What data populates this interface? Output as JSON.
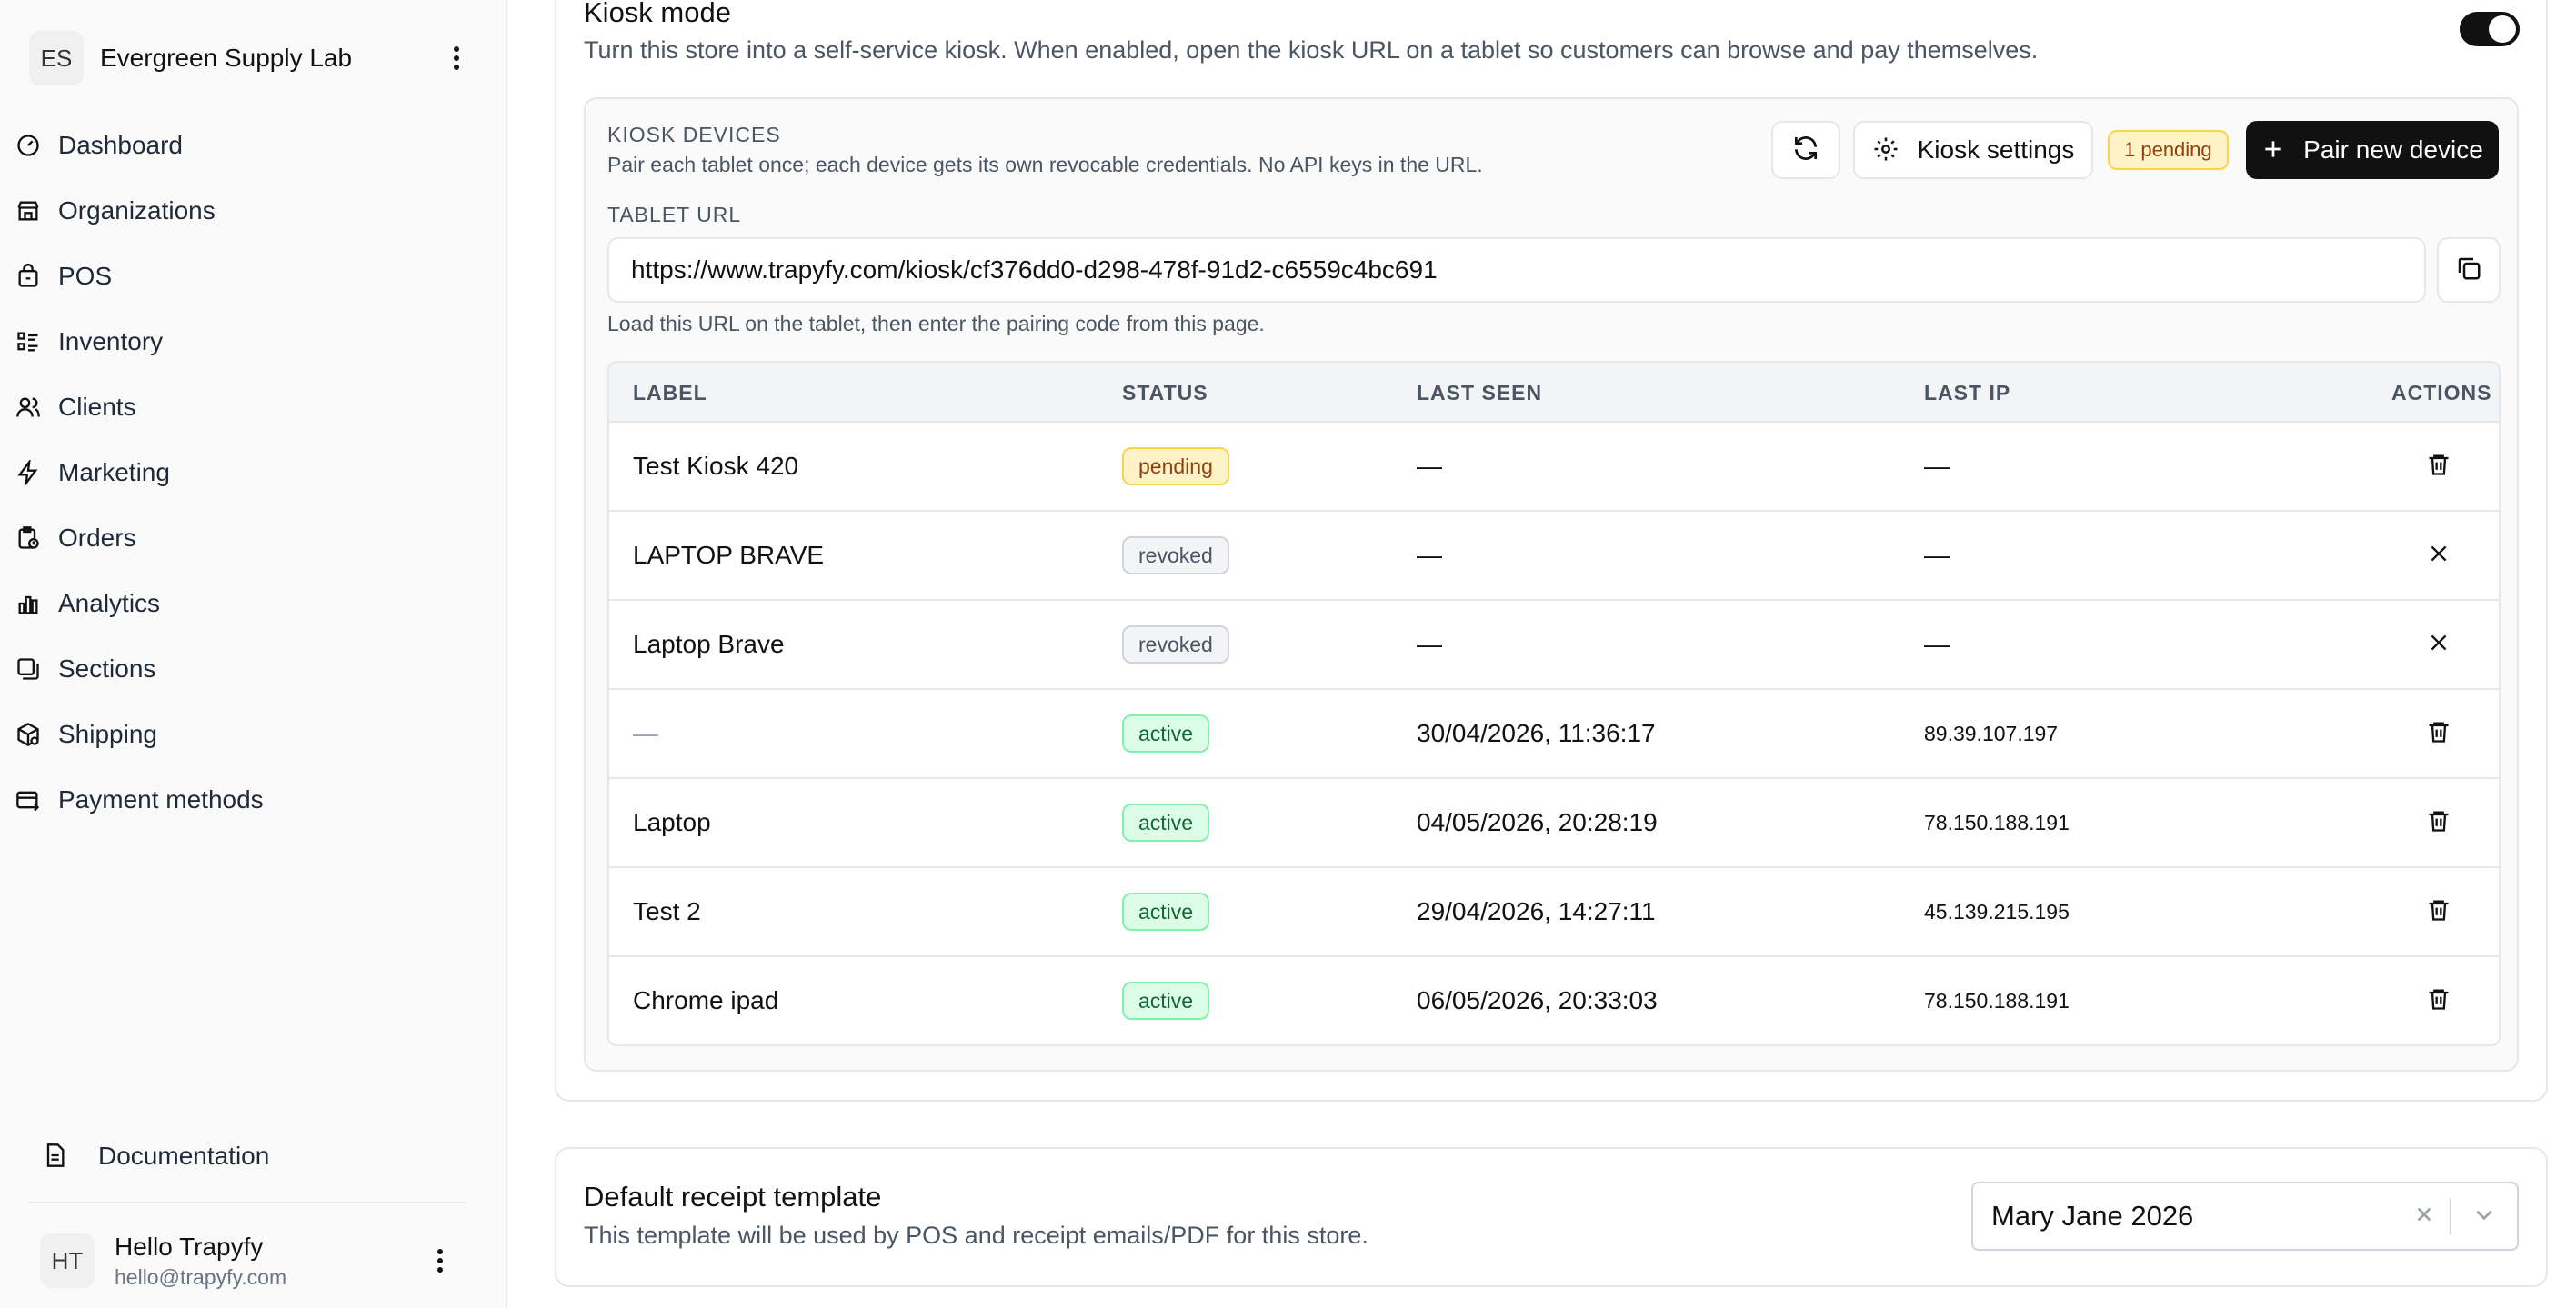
{
  "sidebar": {
    "org": {
      "initials": "ES",
      "name": "Evergreen Supply Lab"
    },
    "items": [
      {
        "label": "Dashboard",
        "icon": "dashboard-icon"
      },
      {
        "label": "Organizations",
        "icon": "store-icon"
      },
      {
        "label": "POS",
        "icon": "bag-icon"
      },
      {
        "label": "Inventory",
        "icon": "list-icon"
      },
      {
        "label": "Clients",
        "icon": "users-icon"
      },
      {
        "label": "Marketing",
        "icon": "bolt-icon"
      },
      {
        "label": "Orders",
        "icon": "clipboard-icon"
      },
      {
        "label": "Analytics",
        "icon": "chart-icon"
      },
      {
        "label": "Sections",
        "icon": "copy-icon"
      },
      {
        "label": "Shipping",
        "icon": "package-icon"
      },
      {
        "label": "Payment methods",
        "icon": "card-icon"
      }
    ],
    "documentation": "Documentation",
    "user": {
      "initials": "HT",
      "name": "Hello Trapyfy",
      "email": "hello@trapyfy.com"
    }
  },
  "kiosk": {
    "title": "Kiosk mode",
    "description": "Turn this store into a self-service kiosk. When enabled, open the kiosk URL on a tablet so customers can browse and pay themselves.",
    "enabled": true,
    "devices": {
      "heading": "KIOSK DEVICES",
      "subtitle": "Pair each tablet once; each device gets its own revocable credentials. No API keys in the URL.",
      "settings_label": "Kiosk settings",
      "pending_label": "1 pending",
      "pair_label": "Pair new device"
    },
    "tablet_url": {
      "label": "TABLET URL",
      "value": "https://www.trapyfy.com/kiosk/cf376dd0-d298-478f-91d2-c6559c4bc691",
      "help": "Load this URL on the tablet, then enter the pairing code from this page."
    },
    "table": {
      "headers": {
        "label": "LABEL",
        "status": "STATUS",
        "last_seen": "LAST SEEN",
        "last_ip": "LAST IP",
        "actions": "ACTIONS"
      },
      "rows": [
        {
          "label": "Test Kiosk 420",
          "status": "pending",
          "last_seen": "—",
          "last_ip": "—",
          "action": "delete"
        },
        {
          "label": "LAPTOP BRAVE",
          "status": "revoked",
          "last_seen": "—",
          "last_ip": "—",
          "action": "remove"
        },
        {
          "label": "Laptop Brave",
          "status": "revoked",
          "last_seen": "—",
          "last_ip": "—",
          "action": "remove"
        },
        {
          "label": "—",
          "status": "active",
          "last_seen": "30/04/2026, 11:36:17",
          "last_ip": "89.39.107.197",
          "action": "delete"
        },
        {
          "label": "Laptop",
          "status": "active",
          "last_seen": "04/05/2026, 20:28:19",
          "last_ip": "78.150.188.191",
          "action": "delete"
        },
        {
          "label": "Test 2",
          "status": "active",
          "last_seen": "29/04/2026, 14:27:11",
          "last_ip": "45.139.215.195",
          "action": "delete"
        },
        {
          "label": "Chrome ipad",
          "status": "active",
          "last_seen": "06/05/2026, 20:33:03",
          "last_ip": "78.150.188.191",
          "action": "delete"
        }
      ]
    }
  },
  "receipt": {
    "title": "Default receipt template",
    "description": "This template will be used by POS and receipt emails/PDF for this store.",
    "selected": "Mary Jane 2026"
  }
}
